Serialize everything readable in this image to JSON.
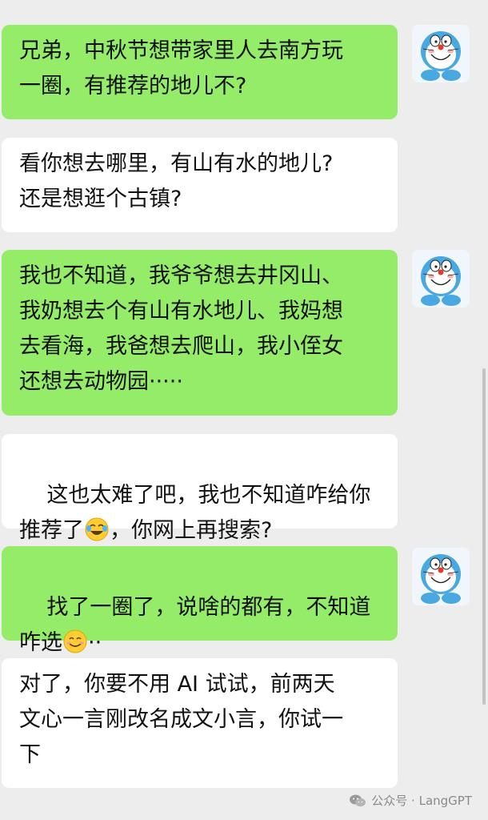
{
  "messages": [
    {
      "side": "out",
      "text": "兄弟，中秋节想带家里人去南方玩\n一圈，有推荐的地儿不?"
    },
    {
      "side": "in",
      "text": "看你想去哪里，有山有水的地儿?\n还是想逛个古镇?"
    },
    {
      "side": "out",
      "text": "我也不知道，我爷爷想去井冈山、\n我奶想去个有山有水地儿、我妈想\n去看海，我爸想去爬山，我小侄女\n还想去动物园·····"
    },
    {
      "side": "in",
      "text_before": "这也太难了吧，我也不知道咋给你\n推荐了",
      "emoji": "laughing-tears-emoji",
      "text_after": "，你网上再搜索?"
    },
    {
      "side": "out",
      "text_before": "找了一圈了，说啥的都有，不知道\n咋选",
      "emoji": "smile-emoji",
      "text_after": "··"
    },
    {
      "side": "in",
      "text": "对了，你要不用 AI 试试，前两天\n文心一言刚改名成文小言，你试一\n下"
    }
  ],
  "avatar_icon": "doraemon-avatar",
  "watermark": {
    "text": "公众号 · LangGPT",
    "icon": "wechat-icon"
  },
  "colors": {
    "background": "#ededed",
    "outgoing_bubble": "#95ec69",
    "incoming_bubble": "#ffffff"
  }
}
